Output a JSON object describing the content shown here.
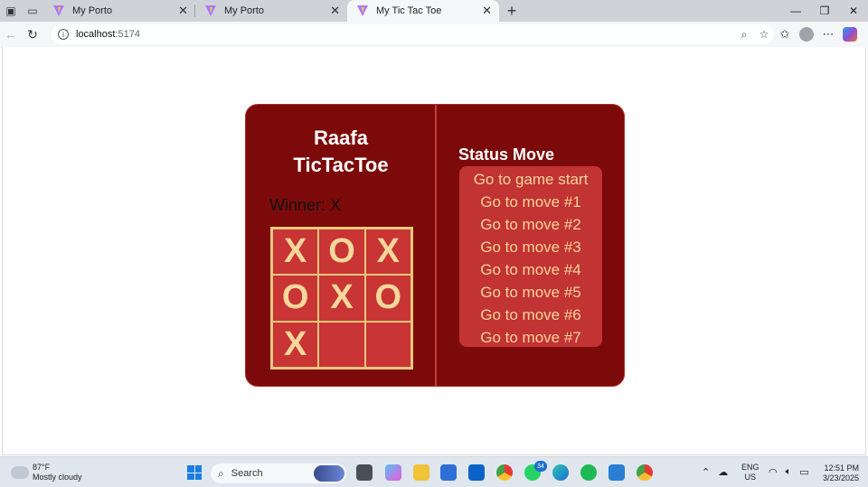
{
  "browser": {
    "tabs": [
      {
        "title": "My Porto",
        "active": false
      },
      {
        "title": "My Porto",
        "active": false
      },
      {
        "title": "My Tic Tac Toe",
        "active": true
      }
    ],
    "url_host": "localhost",
    "url_port": ":5174"
  },
  "game": {
    "title_line1": "Raafa",
    "title_line2": "TicTacToe",
    "winner_text": "Winner: X",
    "board": [
      "X",
      "O",
      "X",
      "O",
      "X",
      "O",
      "X",
      "",
      ""
    ],
    "status_title": "Status Move",
    "moves": [
      "Go to game start",
      "Go to move #1",
      "Go to move #2",
      "Go to move #3",
      "Go to move #4",
      "Go to move #5",
      "Go to move #6",
      "Go to move #7"
    ],
    "colors": {
      "card_bg": "#7d0a0a",
      "board_bg": "#c93434",
      "mark_color": "#f7d79a",
      "moves_bg": "#c23333"
    }
  },
  "taskbar": {
    "weather_temp": "87°F",
    "weather_desc": "Mostly cloudy",
    "search_label": "Search",
    "badge_count": "34",
    "lang_line1": "ENG",
    "lang_line2": "US",
    "time": "12:51 PM",
    "date": "3/23/2025"
  }
}
